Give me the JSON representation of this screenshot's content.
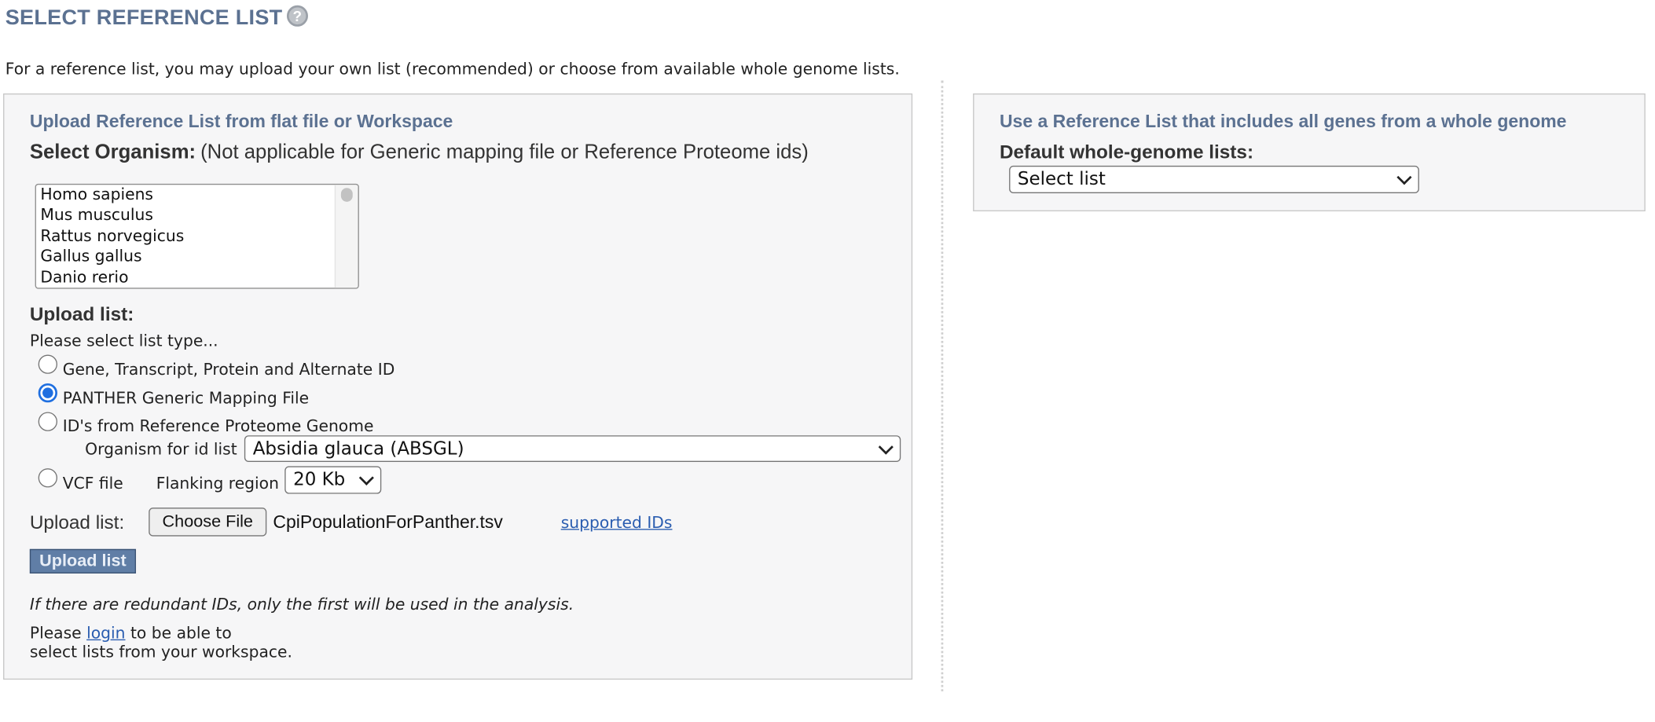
{
  "header": {
    "title": "SELECT REFERENCE LIST",
    "help_icon": "?",
    "intro": "For a reference list, you may upload your own list (recommended) or choose from available whole genome lists."
  },
  "left_panel": {
    "heading": "Upload Reference List from flat file or Workspace",
    "organism_label": "Select Organism:",
    "organism_note": "(Not applicable for Generic mapping file or Reference Proteome ids)",
    "organisms": [
      "Homo sapiens",
      "Mus musculus",
      "Rattus norvegicus",
      "Gallus gallus",
      "Danio rerio"
    ],
    "upload_list_heading": "Upload list:",
    "list_type_prompt": "Please select list type...",
    "list_types": [
      {
        "label": "Gene, Transcript, Protein and Alternate ID",
        "checked": false
      },
      {
        "label": "PANTHER Generic Mapping File",
        "checked": true
      },
      {
        "label": "ID's from Reference Proteome Genome",
        "checked": false
      },
      {
        "label": "VCF file",
        "checked": false
      }
    ],
    "organism_for_id_label": "Organism for id list",
    "organism_for_id_value": "Absidia glauca (ABSGL)",
    "flanking_label": "Flanking region",
    "flanking_value": "20 Kb",
    "upload_label": "Upload list:",
    "choose_file_label": "Choose File",
    "file_name": "CpiPopulationForPanther.tsv",
    "supported_ids_link": "supported IDs",
    "upload_button": "Upload list",
    "redundant_note": "If there are redundant IDs, only the first will be used in the analysis.",
    "login_prefix": "Please",
    "login_link": "login",
    "login_suffix": "to be able to",
    "login_line2": "select lists from your workspace."
  },
  "right_panel": {
    "heading": "Use a Reference List that includes all genes from a whole genome",
    "default_label": "Default whole-genome lists:",
    "select_value": "Select list"
  },
  "colors": {
    "heading": "#5b7191",
    "panel_bg": "#f6f6f7",
    "radio_checked": "#1f6fe0",
    "button_bg": "#607ea6",
    "link": "#2a5db0"
  }
}
